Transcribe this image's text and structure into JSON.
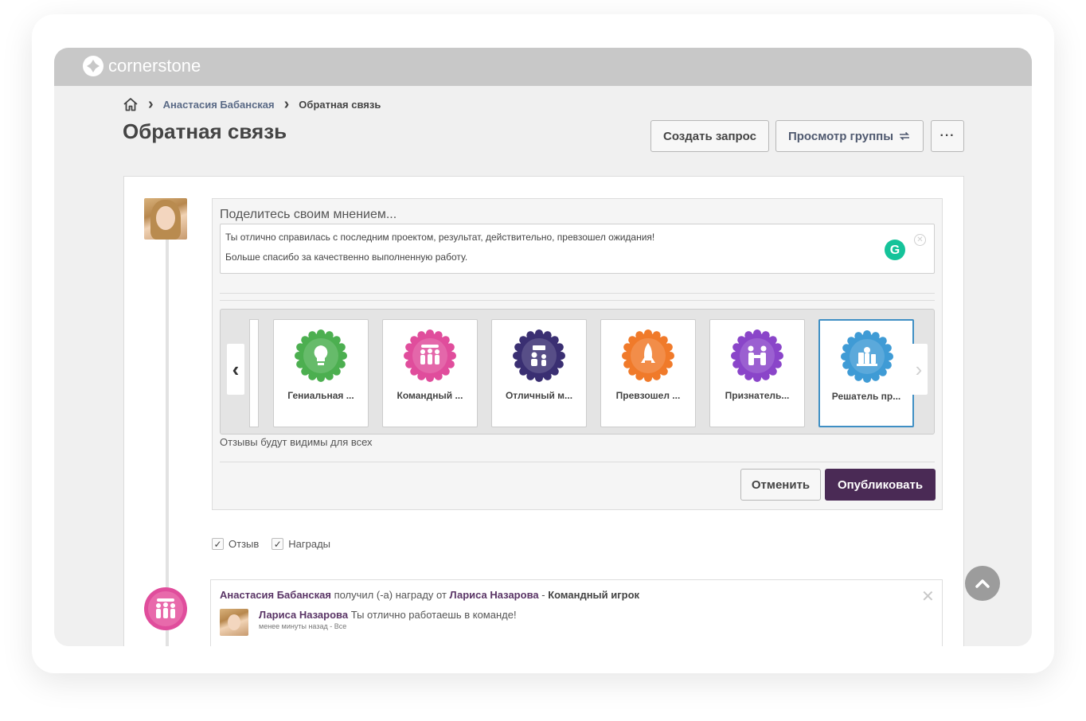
{
  "app": {
    "logo_text": "cornerstone"
  },
  "breadcrumb": {
    "parent": "Анастасия Бабанская",
    "current": "Обратная связь"
  },
  "page": {
    "title": "Обратная связь"
  },
  "header_actions": {
    "create_request": "Создать запрос",
    "view_group": "Просмотр группы",
    "more": "···"
  },
  "composer": {
    "prompt": "Поделитесь своим мнением...",
    "text_line1": "Ты отлично справилась с последним проектом, результат, действительно, превзошел ожидания!",
    "text_line2": "Больше спасибо за качественно выполненную работу.",
    "grammar_icon_letter": "G",
    "visibility_note": "Отзывы будут видимы для всех",
    "cancel": "Отменить",
    "publish": "Опубликовать"
  },
  "badges": [
    {
      "label": "Гениальная ...",
      "color": "#4caf50",
      "icon": "lightbulb-icon",
      "selected": false
    },
    {
      "label": "Командный ...",
      "color": "#e04d9c",
      "icon": "team-icon",
      "selected": false
    },
    {
      "label": "Отличный м...",
      "color": "#3a2f72",
      "icon": "mentor-icon",
      "selected": false
    },
    {
      "label": "Превзошел ...",
      "color": "#f07a2a",
      "icon": "rocket-icon",
      "selected": false
    },
    {
      "label": "Признатель...",
      "color": "#8a45c9",
      "icon": "handshake-icon",
      "selected": false
    },
    {
      "label": "Решатель пр...",
      "color": "#3f9bd5",
      "icon": "chess-icon",
      "selected": true
    }
  ],
  "filters": [
    {
      "label": "Отзыв",
      "checked": true
    },
    {
      "label": "Награды",
      "checked": true
    }
  ],
  "feed": {
    "recipient": "Анастасия Бабанская",
    "action": "получил (-а) награду от",
    "giver": "Лариса Назарова",
    "separator": "-",
    "award": "Командный игрок",
    "comment_author": "Лариса Назарова",
    "comment_text": "Ты отлично работаешь в команде!",
    "meta": "менее минуты назад - Все",
    "close": "✕"
  },
  "colors": {
    "publish_bg": "#4a2a55",
    "link": "#5a3566",
    "selected_border": "#3f8fc4",
    "topbar": "#c8c8c8"
  }
}
